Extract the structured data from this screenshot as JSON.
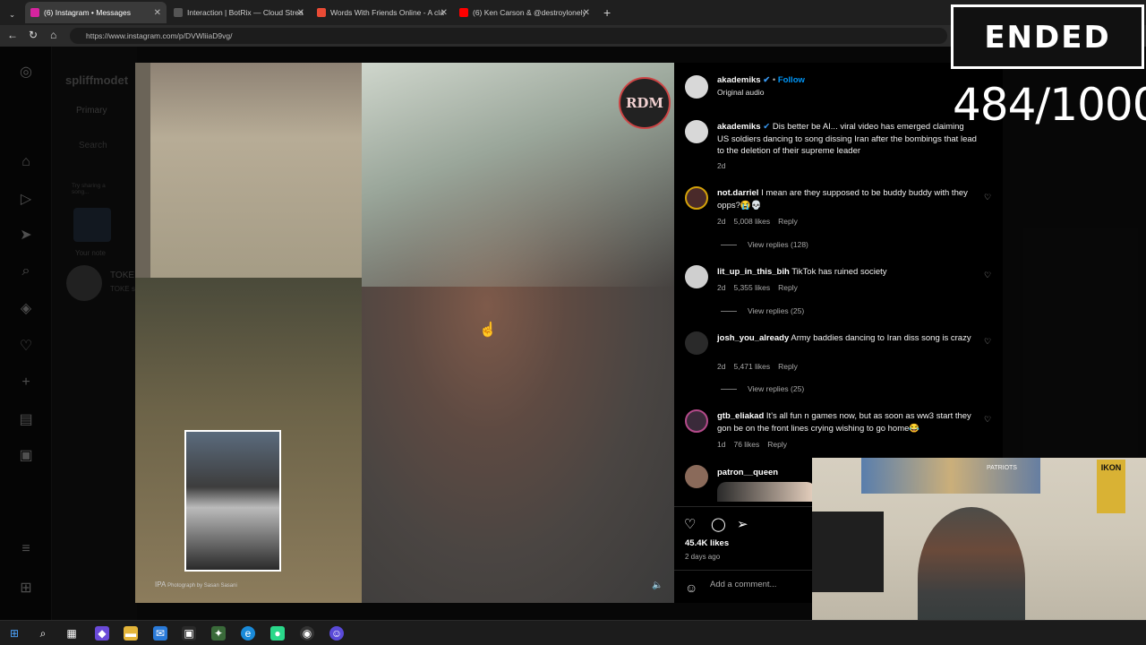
{
  "browser": {
    "tabs": [
      {
        "label": "(6) Instagram • Messages",
        "color": "#d6249f"
      },
      {
        "label": "Interaction | BotRix — Cloud Strea",
        "color": "#555555"
      },
      {
        "label": "Words With Friends Online - A cla",
        "color": "#e94b35"
      },
      {
        "label": "(6) Ken Carson & @destroylonely",
        "color": "#ff0000"
      }
    ],
    "url": "https://www.instagram.com/p/DVWliiaD9vg/"
  },
  "background_page": {
    "username": "spliffmodet",
    "primary_tab": "Primary",
    "search_placeholder": "Search",
    "note_hint": "Try sharing a song...",
    "your_note": "Your note",
    "conversation_name": "TOKE",
    "conversation_sub": "TOKE s",
    "notification_count": "6"
  },
  "post": {
    "watermark": "IPA",
    "photo_credit": "Photograph by Sasan Sasani",
    "logo_text": "RDM",
    "author": {
      "username": "akademiks",
      "follow": "Follow",
      "subtitle": "Original audio"
    },
    "caption": {
      "username": "akademiks",
      "text": "Dis better be AI... viral video has emerged claiming US soldiers dancing to song dissing Iran after the bombings that lead to the deletion of their supreme leader",
      "time": "2d"
    },
    "comments": [
      {
        "username": "not.darriel",
        "text": "I mean are they supposed to be buddy buddy with they opps?😭💀",
        "time": "2d",
        "likes": "5,008 likes",
        "reply": "Reply",
        "view_replies": "View replies (128)"
      },
      {
        "username": "lit_up_in_this_bih",
        "text": "TikTok has ruined society",
        "time": "2d",
        "likes": "5,355 likes",
        "reply": "Reply",
        "view_replies": "View replies (25)"
      },
      {
        "username": "josh_you_already",
        "text": "Army baddies dancing to Iran diss song is crazy",
        "time": "2d",
        "likes": "5,471 likes",
        "reply": "Reply",
        "view_replies": "View replies (25)"
      },
      {
        "username": "gtb_eliakad",
        "text": "It's all fun n games now, but as soon as ww3 start they gon be on the front lines crying wishing to go home😂",
        "time": "1d",
        "likes": "76 likes",
        "reply": "Reply",
        "view_replies": ""
      },
      {
        "username": "patron__queen",
        "text": "",
        "time": "",
        "likes": "",
        "reply": "",
        "view_replies": ""
      }
    ],
    "likes_total": "45.4K likes",
    "posted": "2 days ago",
    "add_comment_placeholder": "Add a comment..."
  },
  "stream_overlay": {
    "status": "ENDED",
    "counter": "484/1000",
    "cam_sign": "IKON",
    "banner": "PATRIOTS"
  }
}
